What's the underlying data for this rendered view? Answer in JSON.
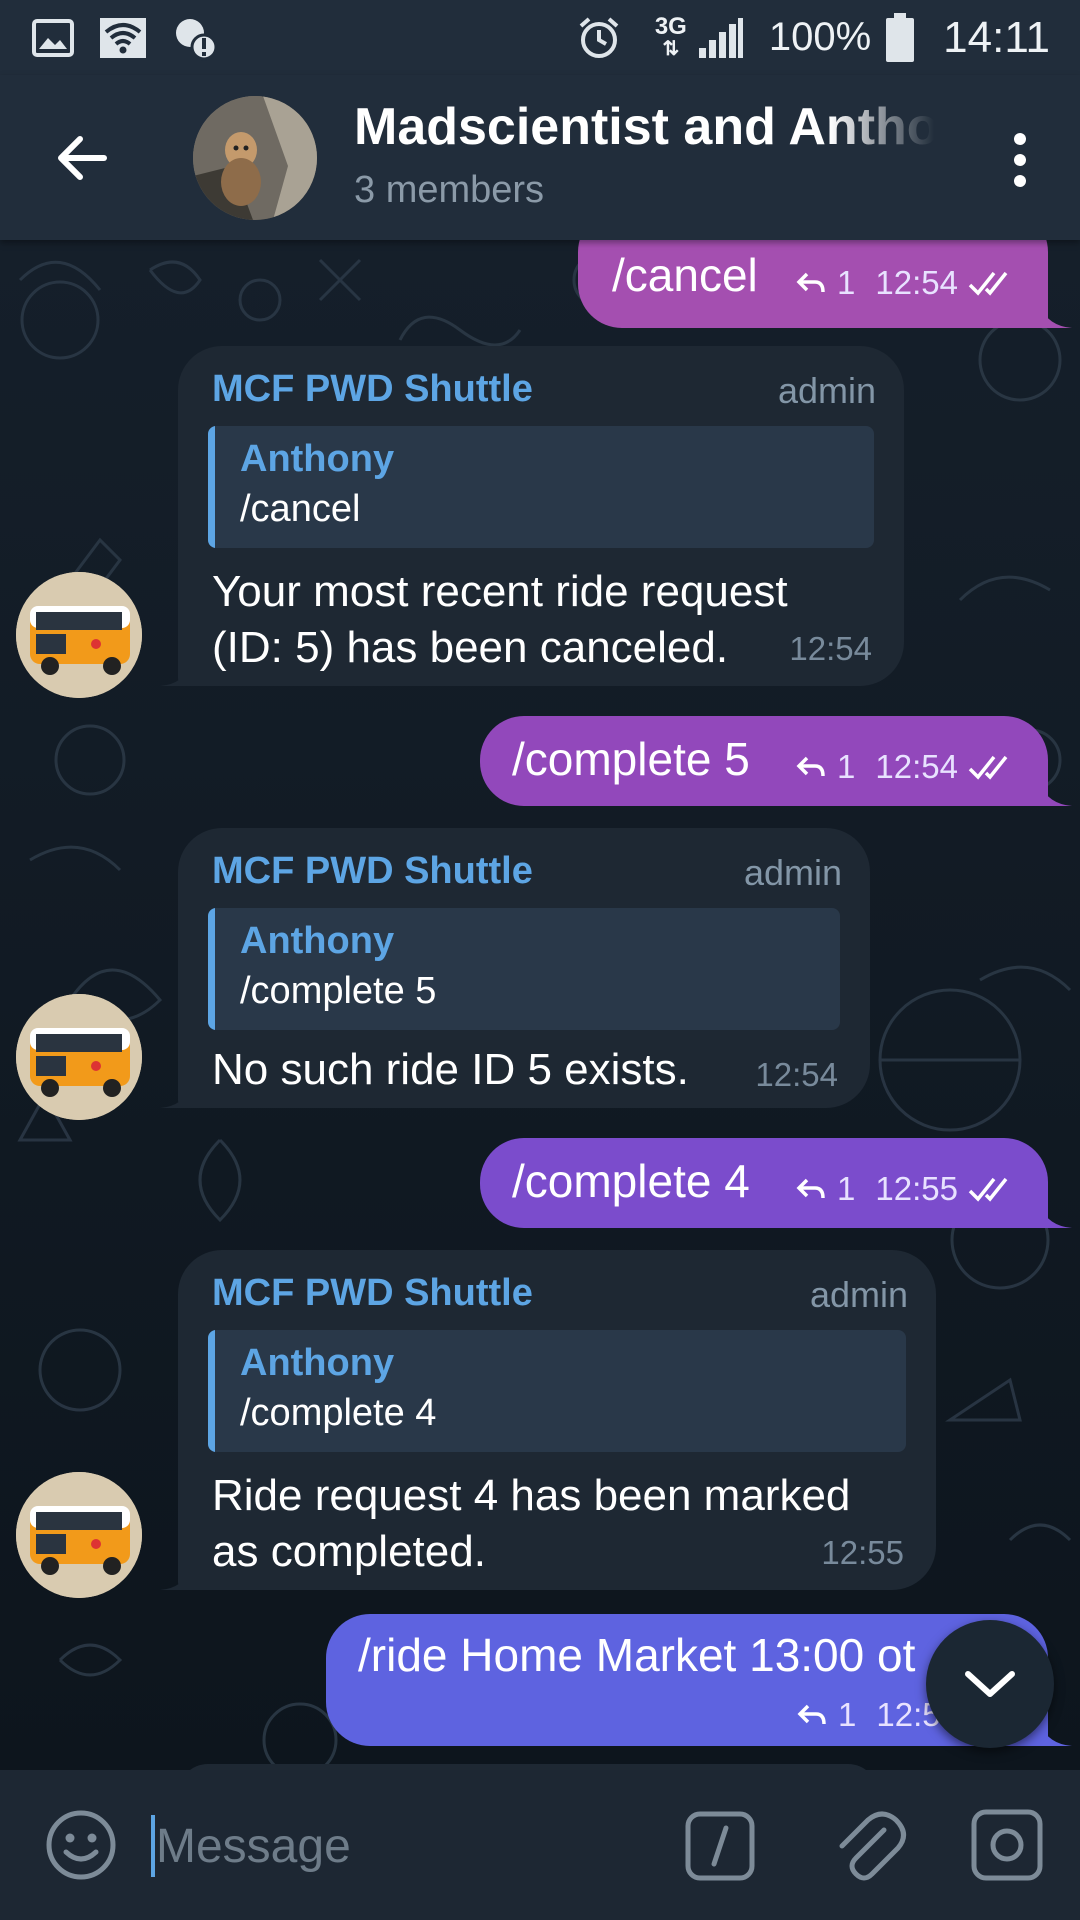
{
  "status_bar": {
    "battery_percent": "100%",
    "time": "14:11",
    "network": "3G"
  },
  "header": {
    "title": "Madscientist and Anthony",
    "subtitle": "3 members"
  },
  "messages": [
    {
      "type": "outgoing",
      "text": "/cancel",
      "replies": "1",
      "time": "12:54",
      "color": "#a44fb0"
    },
    {
      "type": "incoming",
      "sender": "MCF PWD Shuttle",
      "badge": "admin",
      "quote_name": "Anthony",
      "quote_text": "/cancel",
      "text_lines": [
        "Your most recent ride request",
        "(ID: 5) has been canceled."
      ],
      "time": "12:54"
    },
    {
      "type": "outgoing",
      "text": "/complete 5",
      "replies": "1",
      "time": "12:54",
      "color": "#9248bb"
    },
    {
      "type": "incoming",
      "sender": "MCF PWD Shuttle",
      "badge": "admin",
      "quote_name": "Anthony",
      "quote_text": "/complete 5",
      "text_lines": [
        "No such ride ID 5 exists."
      ],
      "time": "12:54"
    },
    {
      "type": "outgoing",
      "text": "/complete 4",
      "replies": "1",
      "time": "12:55",
      "color": "#7b4ccc"
    },
    {
      "type": "incoming",
      "sender": "MCF PWD Shuttle",
      "badge": "admin",
      "quote_name": "Anthony",
      "quote_text": "/complete 4",
      "text_lines": [
        "Ride request 4 has been marked",
        "as completed."
      ],
      "time": "12:55"
    },
    {
      "type": "outgoing",
      "text": "/ride Home Market 13:00 ot",
      "replies": "1",
      "time": "12:5",
      "color": "#5e63e0"
    }
  ],
  "input": {
    "placeholder": "Message"
  },
  "icons": [
    "gallery-icon",
    "wifi-icon",
    "data-alert-icon",
    "alarm-icon",
    "signal-icon",
    "battery-icon",
    "back-arrow-icon",
    "more-vert-icon",
    "reply-icon",
    "double-check-icon",
    "chevron-down-icon",
    "emoji-icon",
    "slash-command-icon",
    "paperclip-icon",
    "camera-icon"
  ]
}
